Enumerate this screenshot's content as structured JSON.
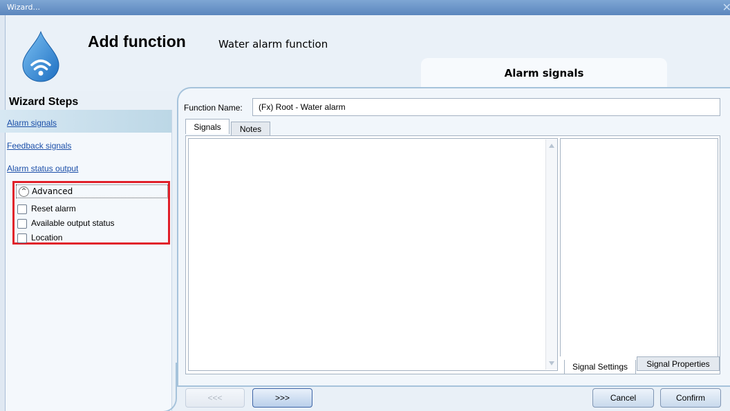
{
  "window": {
    "title": "Wizard...",
    "close_glyph": "✕"
  },
  "header": {
    "title": "Add function",
    "subtitle": "Water alarm function",
    "step_tab": "Alarm signals",
    "logo_icon": "water-drop-wireless-icon",
    "colors": {
      "drop": "#2b7fd0"
    }
  },
  "sidebar": {
    "title": "Wizard Steps",
    "items": [
      {
        "label": "Alarm signals",
        "active": true
      },
      {
        "label": "Feedback signals",
        "active": false
      },
      {
        "label": "Alarm status output",
        "active": false
      }
    ],
    "advanced": {
      "label": "Advanced",
      "toggle_glyph": "^",
      "options": [
        {
          "label": "Reset alarm",
          "checked": false
        },
        {
          "label": "Available output status",
          "checked": false
        },
        {
          "label": "Location",
          "checked": false
        }
      ]
    },
    "highlight_color": "#e1202a"
  },
  "main": {
    "function_name_label": "Function Name:",
    "function_name_value": "(Fx) Root - Water alarm",
    "tabs": [
      {
        "label": "Signals",
        "selected": true
      },
      {
        "label": "Notes",
        "selected": false
      }
    ],
    "bottom_tabs": [
      {
        "label": "Signal Settings",
        "selected": true
      },
      {
        "label": "Signal Properties",
        "selected": false
      }
    ]
  },
  "footer": {
    "prev_label": "<<<",
    "next_label": ">>>",
    "cancel_label": "Cancel",
    "confirm_label": "Confirm"
  }
}
